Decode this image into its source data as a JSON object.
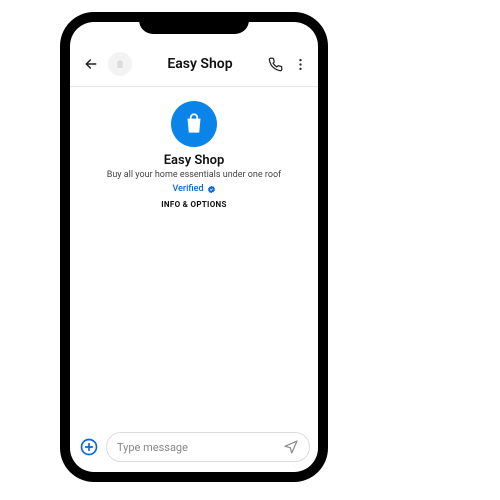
{
  "header": {
    "title": "Easy Shop"
  },
  "business": {
    "name": "Easy Shop",
    "tagline": "Buy all your home essentials under one roof",
    "verified_label": "Verified",
    "info_options_label": "INFO & OPTIONS"
  },
  "composer": {
    "placeholder": "Type message"
  },
  "colors": {
    "accent": "#0a66e0",
    "logo_bg": "#0a84e8"
  }
}
